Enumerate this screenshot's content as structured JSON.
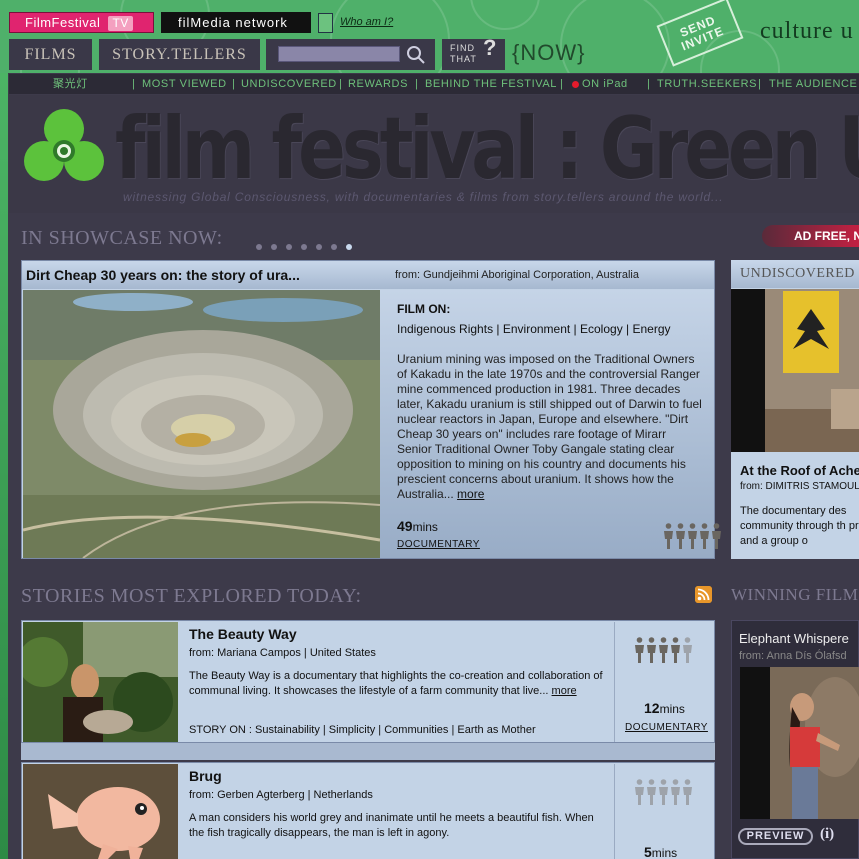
{
  "header": {
    "brand_film": "Film",
    "brand_festival": "Festival",
    "brand_tv": "TV",
    "network": "filMedia network",
    "who_link": "Who am I?",
    "films_tab": "FILMS",
    "storytellers_tab": "STORY.TELLERS",
    "search_placeholder": "",
    "find_that": "FIND THAT",
    "now": "{NOW}",
    "send_invite": "SEND INVITE",
    "culture": "culture u",
    "accent_color": "#4fb06a",
    "brand_color": "#e0246f"
  },
  "nav": {
    "items": [
      "聚光灯",
      "MOST VIEWED",
      "UNDISCOVERED",
      "REWARDS",
      "BEHIND THE FESTIVAL",
      "ON iPad",
      "TRUTH.SEEKERS",
      "THE AUDIENCE"
    ],
    "live_dot_color": "#e41b2c"
  },
  "banner": {
    "title": "film festival : Green Unplu",
    "tagline": "witnessing Global Consciousness, with documentaries & films from story.tellers around the world..."
  },
  "showcase": {
    "heading": "IN SHOWCASE NOW:",
    "slides": 7,
    "active_slide": 7,
    "ad_free": "AD FREE, N",
    "feature": {
      "title": "Dirt Cheap 30 years on: the story of ura...",
      "from": "from: Gundjeihmi Aboriginal Corporation, Australia",
      "film_on_label": "FILM ON:",
      "tags": "Indigenous Rights | Environment | Ecology | Energy",
      "description": "Uranium mining was imposed on the Traditional Owners of Kakadu in the late 1970s and the controversial Ranger mine commenced production in 1981. Three decades later, Kakadu uranium is still shipped out of Darwin to fuel nuclear reactors in Japan, Europe and elsewhere. \"Dirt Cheap 30 years on\" includes rare footage of Mirarr Senior Traditional Owner Toby Gangale stating clear opposition to mining on his country and documents his prescient concerns about uranium. It shows how the Australia...",
      "more": "more",
      "minutes": "49",
      "mins_label": "mins",
      "type": "DOCUMENTARY",
      "rating": 5
    }
  },
  "undiscovered": {
    "heading": "UNDISCOVERED",
    "title": "At the Roof of Ache",
    "from": "from: DIMITRIS STAMOUL",
    "description": "The documentary des community through th prefect, and a group o"
  },
  "stories": {
    "heading": "STORIES MOST EXPLORED TODAY:",
    "items": [
      {
        "title": "The Beauty Way",
        "from": "from: Mariana Campos | United States",
        "description": "The Beauty Way is a documentary that highlights the co-creation and collaboration of communal living. It showcases the lifestyle of a farm community that live...",
        "more": "more",
        "tags": "STORY ON : Sustainability | Simplicity | Communities | Earth as Mother",
        "minutes": "12",
        "mins_label": "mins",
        "type": "DOCUMENTARY",
        "rating": 4
      },
      {
        "title": "Brug",
        "from": "from: Gerben Agterberg | Netherlands",
        "description": "A man considers his world grey and inanimate until he meets a beautiful fish. When the fish tragically disappears, the man is left in agony.",
        "minutes": "5",
        "mins_label": "mins",
        "rating": 0
      }
    ]
  },
  "winning": {
    "heading": "WINNING FILM",
    "title": "Elephant Whispere",
    "from": "from: Anna Dís Ólafsd",
    "preview": "PREVIEW",
    "info": "(i)"
  }
}
